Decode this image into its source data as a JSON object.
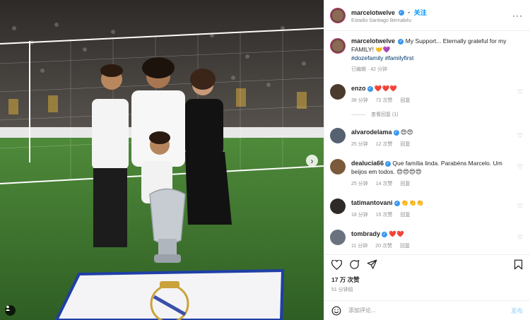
{
  "account": {
    "username": "marcelotwelve",
    "follow_label": "关注",
    "location": "Estadio Santiago Bernabéu",
    "more_icon": "more-dots-icon"
  },
  "caption": {
    "text": "My Support... Eternally grateful for my FAMILY! 🤝💜",
    "hashtags": "#dozefamily #familyfirst",
    "meta": "已编辑 · 42 分钟"
  },
  "comments": [
    {
      "user": "enzo",
      "text": "❤️❤️❤️",
      "time": "38 分钟",
      "likes": "72 次赞",
      "reply": "回复",
      "avatar_color": "#4a3b2e",
      "view_replies": "查看回复 (1)"
    },
    {
      "user": "alvarodelama",
      "text": "😍😍",
      "time": "25 分钟",
      "likes": "12 次赞",
      "reply": "回复",
      "avatar_color": "#556070"
    },
    {
      "user": "dealucia66",
      "text": "Que família linda. Parabéns Marcelo. Um beijos em todos. 😍😍😍😍",
      "time": "25 分钟",
      "likes": "14 次赞",
      "reply": "回复",
      "avatar_color": "#7a5a3a"
    },
    {
      "user": "tatimantovani",
      "text": "👏👏👏",
      "time": "18 分钟",
      "likes": "15 次赞",
      "reply": "回复",
      "avatar_color": "#2e2a28"
    },
    {
      "user": "tombrady",
      "text": "❤️❤️",
      "time": "11 分钟",
      "likes": "20 次赞",
      "reply": "回复",
      "avatar_color": "#6a7280"
    }
  ],
  "actions": {
    "like_icon": "heart-icon",
    "comment_icon": "comment-icon",
    "share_icon": "share-icon",
    "save_icon": "bookmark-icon"
  },
  "stats": {
    "likes": "17 万 次赞",
    "posted": "51 分钟前"
  },
  "add_comment": {
    "placeholder": "添加评论...",
    "post_label": "发布",
    "emoji_icon": "emoji-icon"
  },
  "colors": {
    "accent": "#0095f6",
    "verified": "#3897f0",
    "heart": "#ed4956"
  }
}
